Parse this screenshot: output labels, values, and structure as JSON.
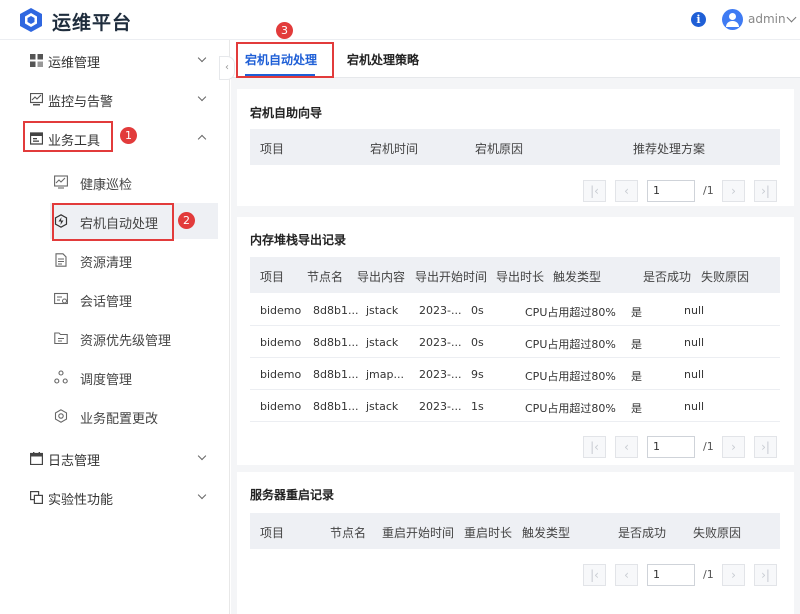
{
  "header": {
    "app_title": "运维平台",
    "info_icon": "i",
    "username": "admin"
  },
  "sidebar": {
    "items": [
      {
        "label": "运维管理",
        "icon": "grid-icon",
        "expanded": false
      },
      {
        "label": "监控与告警",
        "icon": "monitor-icon",
        "expanded": false
      },
      {
        "label": "业务工具",
        "icon": "toolbox-icon",
        "expanded": true
      },
      {
        "label": "日志管理",
        "icon": "calendar-icon",
        "expanded": false
      },
      {
        "label": "实验性功能",
        "icon": "copy-icon",
        "expanded": false
      }
    ],
    "sub_items": [
      {
        "label": "健康巡检",
        "icon": "chart-icon"
      },
      {
        "label": "宕机自动处理",
        "icon": "bolt-icon",
        "active": true
      },
      {
        "label": "资源清理",
        "icon": "document-icon"
      },
      {
        "label": "会话管理",
        "icon": "session-icon"
      },
      {
        "label": "资源优先级管理",
        "icon": "folder-icon"
      },
      {
        "label": "调度管理",
        "icon": "nodes-icon"
      },
      {
        "label": "业务配置更改",
        "icon": "settings-icon"
      }
    ]
  },
  "annotations": {
    "badge1": "1",
    "badge2": "2",
    "badge3": "3",
    "color": "#e23b3b"
  },
  "tabs": [
    {
      "label": "宕机自动处理",
      "active": true
    },
    {
      "label": "宕机处理策略",
      "active": false
    }
  ],
  "crash_guide": {
    "title": "宕机自助向导",
    "columns": [
      "项目",
      "宕机时间",
      "宕机原因",
      "推荐处理方案"
    ],
    "rows": [],
    "pagination": {
      "current": "1",
      "total": "/1"
    }
  },
  "heap_dump": {
    "title": "内存堆栈导出记录",
    "columns": [
      "项目",
      "节点名",
      "导出内容",
      "导出开始时间",
      "导出时长",
      "触发类型",
      "是否成功",
      "失败原因"
    ],
    "rows": [
      [
        "bidemo",
        "8d8b1...",
        "jstack",
        "2023-...",
        "0s",
        "CPU占用超过80%",
        "是",
        "null"
      ],
      [
        "bidemo",
        "8d8b1...",
        "jstack",
        "2023-...",
        "0s",
        "CPU占用超过80%",
        "是",
        "null"
      ],
      [
        "bidemo",
        "8d8b1...",
        "jmap...",
        "2023-...",
        "9s",
        "CPU占用超过80%",
        "是",
        "null"
      ],
      [
        "bidemo",
        "8d8b1...",
        "jstack",
        "2023-...",
        "1s",
        "CPU占用超过80%",
        "是",
        "null"
      ]
    ],
    "pagination": {
      "current": "1",
      "total": "/1"
    }
  },
  "server_restart": {
    "title": "服务器重启记录",
    "columns": [
      "项目",
      "节点名",
      "重启开始时间",
      "重启时长",
      "触发类型",
      "是否成功",
      "失败原因"
    ],
    "rows": [],
    "pagination": {
      "current": "1",
      "total": "/1"
    }
  },
  "pager_glyphs": {
    "first": "|‹",
    "prev": "‹",
    "next": "›",
    "last": "›|"
  },
  "collapse_glyph": "‹"
}
